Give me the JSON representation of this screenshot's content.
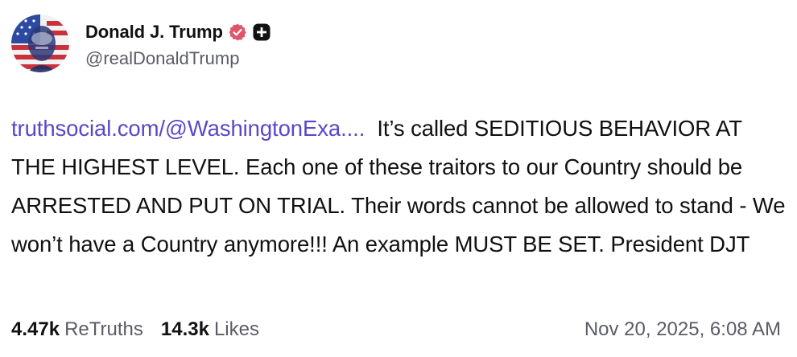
{
  "author": {
    "display_name": "Donald J. Trump",
    "handle": "@realDonaldTrump",
    "avatar_icon": "flag-portrait-avatar",
    "verified_icon": "verified-badge-icon",
    "plus_icon": "plus-badge-icon",
    "verified_color": "#e0556b"
  },
  "post": {
    "link_text": "truthsocial.com/@WashingtonExa....",
    "text": "It’s called SEDITIOUS BEHAVIOR AT THE HIGHEST LEVEL. Each one of these traitors to our Country should be ARRESTED AND PUT ON TRIAL. Their words cannot be allowed to stand - We won’t have a Country anymore!!! An example MUST BE SET. President DJT"
  },
  "stats": {
    "retruths_count": "4.47k",
    "retruths_label": "ReTruths",
    "likes_count": "14.3k",
    "likes_label": "Likes",
    "timestamp": "Nov 20, 2025, 6:08 AM"
  },
  "colors": {
    "link": "#5b46c9",
    "muted": "#5b5b66",
    "text": "#111111"
  }
}
